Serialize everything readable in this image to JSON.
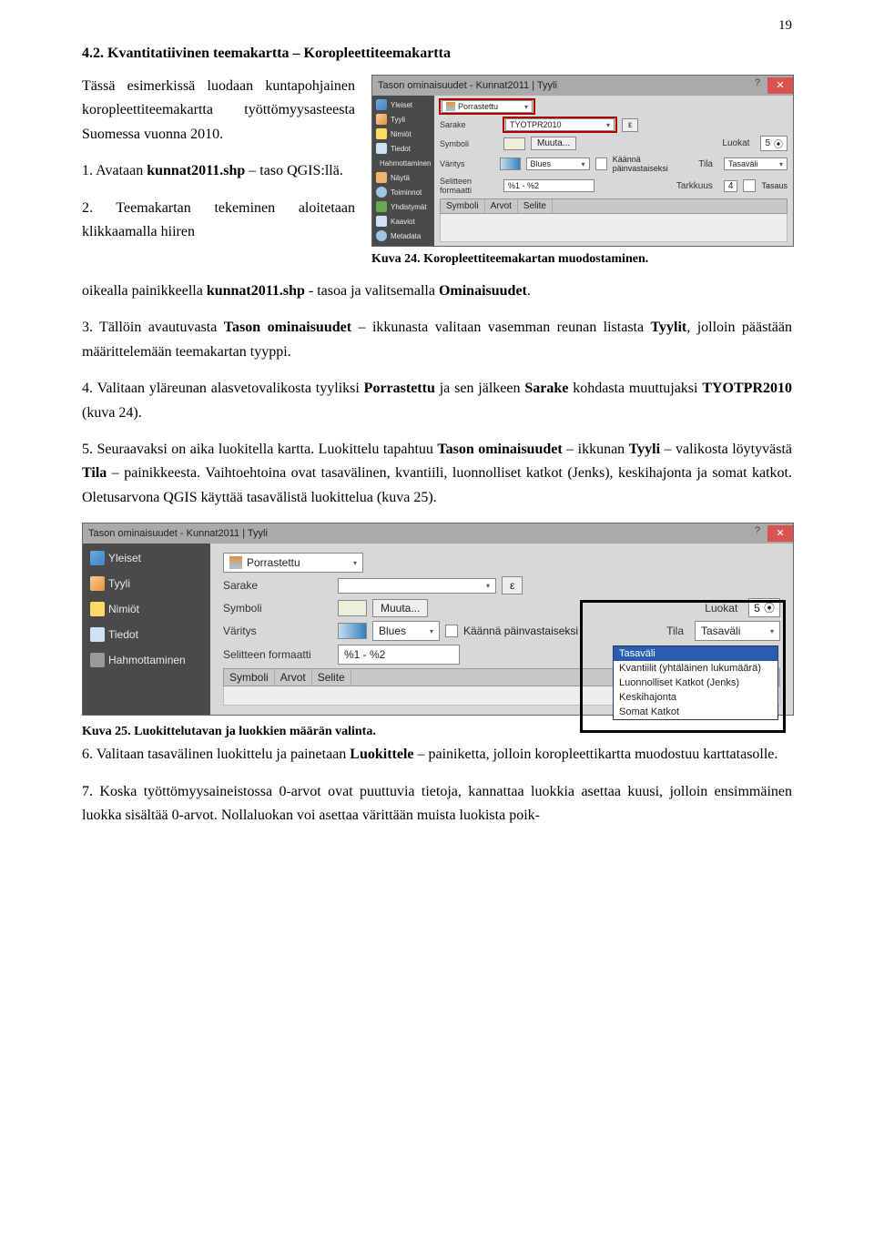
{
  "pageNumber": "19",
  "heading": "4.2. Kvantitatiivinen teemakartta – Koropleettiteemakartta",
  "para1a": "Tässä esimerkissä luodaan kuntapohjainen koropleettiteemakartta työttömyysasteesta Suomessa vuonna 2010.",
  "para1b_prefix": "1. Avataan ",
  "para1b_bold": "kunnat2011.shp",
  "para1b_suffix": " – taso QGIS:llä.",
  "para1c": "2. Teemakartan tekeminen aloitetaan klikkaamalla hiiren",
  "caption24": "Kuva 24. Koropleettiteemakartan muodostaminen.",
  "para_after_fig": "oikealla painikkeella kunnat2011.shp - tasoa ja valitsemalla Ominaisuudet.",
  "para_after_fig_bold1": "kunnat2011.shp",
  "para_after_fig_bold2": "Ominaisuudet",
  "para3_pre": "3. Tällöin avautuvasta ",
  "para3_b1": "Tason ominaisuudet",
  "para3_mid": " – ikkunasta valitaan vasemman reunan listasta ",
  "para3_b2": "Tyylit",
  "para3_suf": ", jolloin päästään määrittelemään teemakartan tyyppi.",
  "para4_pre": "4. Valitaan yläreunan alasvetovalikosta tyyliksi ",
  "para4_b1": "Porrastettu",
  "para4_mid": " ja sen jälkeen ",
  "para4_b2": "Sarake",
  "para4_mid2": " kohdasta muuttujaksi ",
  "para4_b3": "TYOTPR2010",
  "para4_suf": " (kuva 24).",
  "para5_pre": "5. Seuraavaksi on aika luokitella kartta. Luokittelu tapahtuu ",
  "para5_b1": "Tason ominaisuudet",
  "para5_mid1": " – ikkunan ",
  "para5_b2": "Tyyli",
  "para5_mid2": " – valikosta löytyvästä ",
  "para5_b3": "Tila",
  "para5_suf": " – painikkeesta. Vaihtoehtoina ovat tasavälinen, kvantiili, luonnolliset katkot (Jenks), keskihajonta ja somat katkot. Oletusarvona QGIS käyttää tasavälistä luokittelua (kuva 25).",
  "caption25": "Kuva 25. Luokittelutavan ja luokkien määrän valinta.",
  "para6_pre": "6. Valitaan tasavälinen luokittelu ja painetaan ",
  "para6_b1": "Luokittele",
  "para6_suf": " – painiketta, jolloin koropleettikartta muodostuu karttatasolle.",
  "para7": "7. Koska työttömyysaineistossa 0-arvot ovat puuttuvia tietoja, kannattaa luokkia asettaa kuusi, jolloin ensimmäinen luokka sisältää 0-arvot. Nollaluokan voi asettaa värittään muista luokista poik-",
  "shot": {
    "title": "Tason ominaisuudet - Kunnat2011 | Tyyli",
    "sidebar": [
      "Yleiset",
      "Tyyli",
      "Nimiöt",
      "Tiedot",
      "Hahmottaminen",
      "Näytä",
      "Toiminnot",
      "Yhdistymät",
      "Kaaviot",
      "Metadata"
    ],
    "sidebar2": [
      "Yleiset",
      "Tyyli",
      "Nimiöt",
      "Tiedot",
      "Hahmottaminen"
    ],
    "porrastettu": "Porrastettu",
    "sarake_label": "Sarake",
    "sarake_value": "TYOTPR2010",
    "eps": "ε",
    "symboli": "Symboli",
    "muuta": "Muuta...",
    "luokat": "Luokat",
    "luokat_val": "5",
    "varitys": "Väritys",
    "blues": "Blues",
    "kaanna": "Käännä päinvastaiseksi",
    "tila": "Tila",
    "tila_val": "Tasaväli",
    "selfmt": "Selitteen formaatti",
    "selfmt_val": "%1 - %2",
    "tarkkuus": "Tarkkuus",
    "tarkkuus_val": "4",
    "tasaus": "Tasaus",
    "th1": "Symboli",
    "th2": "Arvot",
    "th3": "Selite",
    "dd_items": [
      "Tasaväli",
      "Kvantiilit (yhtäläinen lukumäärä)",
      "Luonnolliset Katkot (Jenks)",
      "Keskihajonta",
      "Somat Katkot"
    ]
  }
}
